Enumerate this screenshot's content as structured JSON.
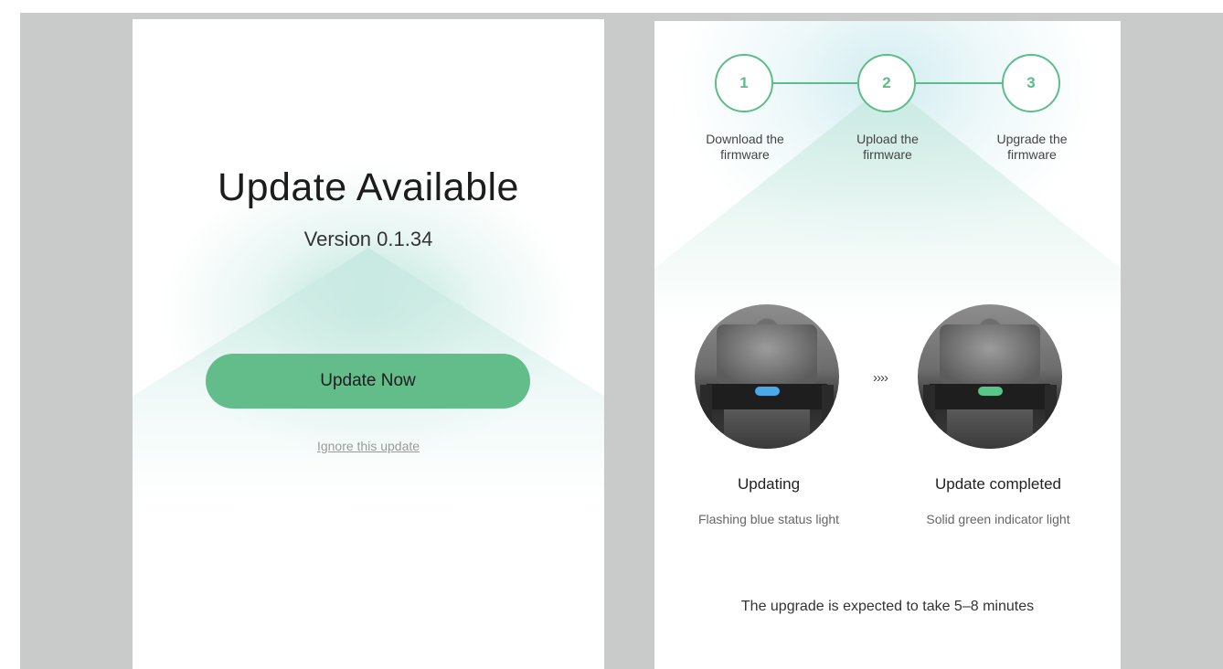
{
  "update_screen": {
    "title": "Update Available",
    "version": "Version 0.1.34",
    "update_button": "Update Now",
    "ignore_link": "Ignore this update",
    "accent_color": "#63bd8b"
  },
  "progress_screen": {
    "steps": [
      {
        "number": "1",
        "label_line1": "Download the",
        "label_line2": "firmware"
      },
      {
        "number": "2",
        "label_line1": "Upload the",
        "label_line2": "firmware"
      },
      {
        "number": "3",
        "label_line1": "Upgrade the",
        "label_line2": "firmware"
      }
    ],
    "arrow": "››››",
    "states": [
      {
        "title": "Updating",
        "description": "Flashing blue status light",
        "light_color": "#4aa9e6"
      },
      {
        "title": "Update completed",
        "description": "Solid green indicator light",
        "light_color": "#58c58a"
      }
    ],
    "eta_text": "The upgrade is expected to take 5–8 minutes",
    "step_color": "#5cbd89"
  }
}
